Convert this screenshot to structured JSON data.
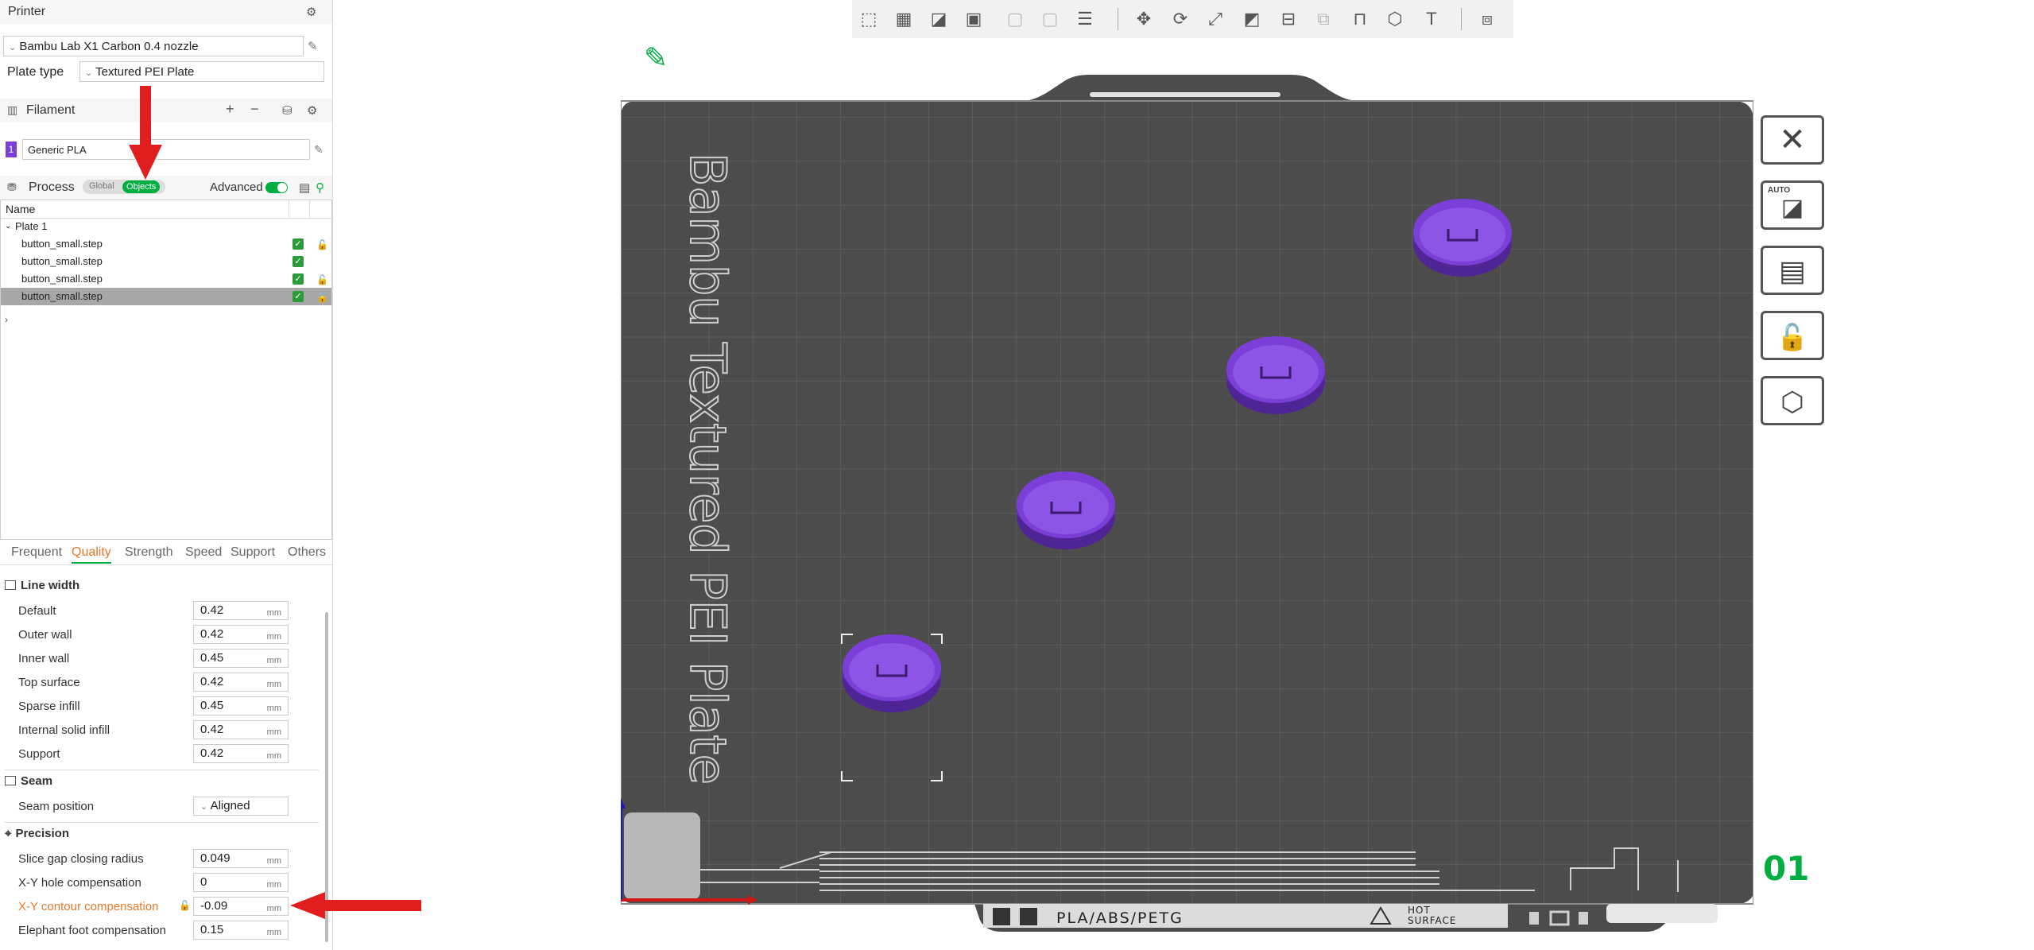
{
  "printer": {
    "section_label": "Printer",
    "name": "Bambu Lab X1 Carbon 0.4 nozzle",
    "plate_type_label": "Plate type",
    "plate_type": "Textured PEI Plate"
  },
  "filament": {
    "section_label": "Filament",
    "slot": "1",
    "name": "Generic PLA",
    "color": "#7a3fd6"
  },
  "process": {
    "section_label": "Process",
    "toggle_global": "Global",
    "toggle_objects": "Objects",
    "advanced_label": "Advanced",
    "advanced_on": true
  },
  "object_list": {
    "header": "Name",
    "plate": "Plate 1",
    "items": [
      {
        "name": "button_small.step",
        "checked": true,
        "locked": true
      },
      {
        "name": "button_small.step",
        "checked": true,
        "locked": false
      },
      {
        "name": "button_small.step",
        "checked": true,
        "locked": true
      },
      {
        "name": "button_small.step",
        "checked": true,
        "locked": true,
        "selected": true
      }
    ]
  },
  "tabs": [
    "Frequent",
    "Quality",
    "Strength",
    "Speed",
    "Support",
    "Others"
  ],
  "active_tab": "Quality",
  "groups": {
    "line_width": {
      "title": "Line width",
      "rows": [
        {
          "label": "Default",
          "value": "0.42",
          "unit": "mm"
        },
        {
          "label": "Outer wall",
          "value": "0.42",
          "unit": "mm"
        },
        {
          "label": "Inner wall",
          "value": "0.45",
          "unit": "mm"
        },
        {
          "label": "Top surface",
          "value": "0.42",
          "unit": "mm"
        },
        {
          "label": "Sparse infill",
          "value": "0.45",
          "unit": "mm"
        },
        {
          "label": "Internal solid infill",
          "value": "0.42",
          "unit": "mm"
        },
        {
          "label": "Support",
          "value": "0.42",
          "unit": "mm"
        }
      ]
    },
    "seam": {
      "title": "Seam",
      "rows": [
        {
          "label": "Seam position",
          "value": "Aligned"
        }
      ]
    },
    "precision": {
      "title": "Precision",
      "rows": [
        {
          "label": "Slice gap closing radius",
          "value": "0.049",
          "unit": "mm"
        },
        {
          "label": "X-Y hole compensation",
          "value": "0",
          "unit": "mm"
        },
        {
          "label": "X-Y contour compensation",
          "value": "-0.09",
          "unit": "mm",
          "modified": true
        },
        {
          "label": "Elephant foot compensation",
          "value": "0.15",
          "unit": "mm"
        }
      ]
    }
  },
  "plate": {
    "name_text": "Bambu Textured PEI Plate",
    "plate_number": "01",
    "footer_text": "PLA/ABS/PETG",
    "hot_surface": [
      "HOT",
      "SURFACE"
    ],
    "auto_label": "AUTO",
    "object_color": "#7b3fd8"
  },
  "colors": {
    "accent": "#00ae42",
    "modified": "#e4792a",
    "annotation_arrow": "#e01e1e"
  }
}
